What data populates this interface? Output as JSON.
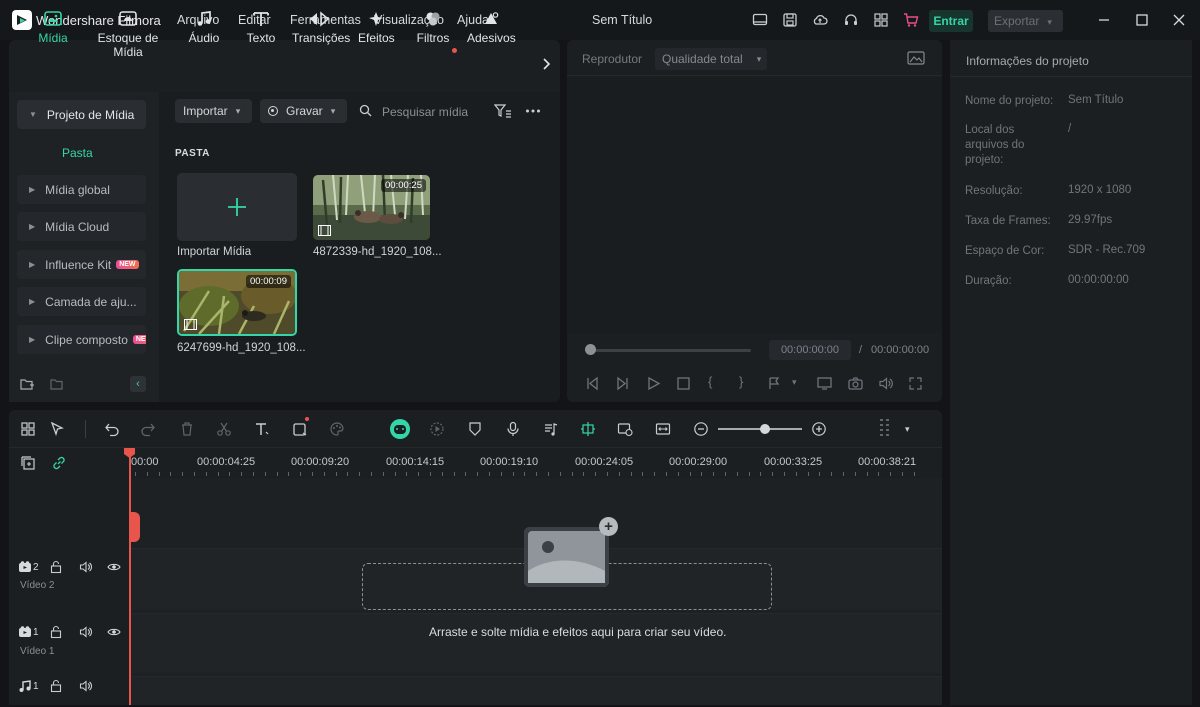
{
  "app": {
    "name": "Wondershare Filmora",
    "doc_title": "Sem Título"
  },
  "menu": [
    "Arquivo",
    "Editar",
    "Ferramentas",
    "Visualização",
    "Ajuda"
  ],
  "header_buttons": {
    "login": "Entrar",
    "export": "Exportar"
  },
  "media_tabs": [
    {
      "label": "Mídia",
      "icon": "media-icon",
      "active": true
    },
    {
      "label": "Estoque de Mídia",
      "icon": "stock-media-icon"
    },
    {
      "label": "Áudio",
      "icon": "music-note-icon"
    },
    {
      "label": "Texto",
      "icon": "text-icon"
    },
    {
      "label": "Transições",
      "icon": "transitions-icon"
    },
    {
      "label": "Efeitos",
      "icon": "effects-icon"
    },
    {
      "label": "Filtros",
      "icon": "filters-icon"
    },
    {
      "label": "Adesivos",
      "icon": "stickers-icon"
    }
  ],
  "sidebar": {
    "items": [
      {
        "label": "Projeto de Mídia",
        "open": true
      },
      {
        "label": "Mídia global"
      },
      {
        "label": "Mídia Cloud"
      },
      {
        "label": "Influence Kit",
        "badge": "NEW"
      },
      {
        "label": "Camada de aju..."
      },
      {
        "label": "Clipe composto",
        "badge": "NEW"
      }
    ],
    "sub_item": "Pasta"
  },
  "media_toolbar": {
    "import": "Importar",
    "record": "Gravar",
    "search_placeholder": "Pesquisar mídia"
  },
  "media_area": {
    "section": "PASTA",
    "import_label": "Importar Mídia",
    "clips": [
      {
        "name": "4872339-hd_1920_108...",
        "duration": "00:00:25"
      },
      {
        "name": "6247699-hd_1920_108...",
        "duration": "00:00:09"
      }
    ]
  },
  "player": {
    "label": "Reprodutor",
    "quality": "Qualidade total",
    "current_time": "00:00:00:00",
    "total_time": "00:00:00:00",
    "separator": "/"
  },
  "project_info": {
    "title": "Informações do projeto",
    "fields": [
      {
        "label": "Nome do projeto:",
        "value": "Sem Título"
      },
      {
        "label": "Local dos arquivos do projeto:",
        "value": "/"
      },
      {
        "label": "Resolução:",
        "value": "1920 x 1080"
      },
      {
        "label": "Taxa de Frames:",
        "value": "29.97fps"
      },
      {
        "label": "Espaço de Cor:",
        "value": "SDR - Rec.709"
      },
      {
        "label": "Duração:",
        "value": "00:00:00:00"
      }
    ]
  },
  "timeline": {
    "ruler": [
      "00:00",
      "00:00:04:25",
      "00:00:09:20",
      "00:00:14:15",
      "00:00:19:10",
      "00:00:24:05",
      "00:00:29:00",
      "00:00:33:25",
      "00:00:38:21"
    ],
    "tracks": [
      {
        "num": "2",
        "name": "Vídeo 2",
        "type": "video"
      },
      {
        "num": "1",
        "name": "Vídeo 1",
        "type": "video"
      },
      {
        "num": "1",
        "name": "",
        "type": "audio"
      }
    ],
    "drop_hint": "Arraste e solte mídia e efeitos aqui para criar seu vídeo."
  },
  "colors": {
    "accent": "#33d6a8",
    "playhead": "#e8554d",
    "panel": "#1c1f22"
  }
}
